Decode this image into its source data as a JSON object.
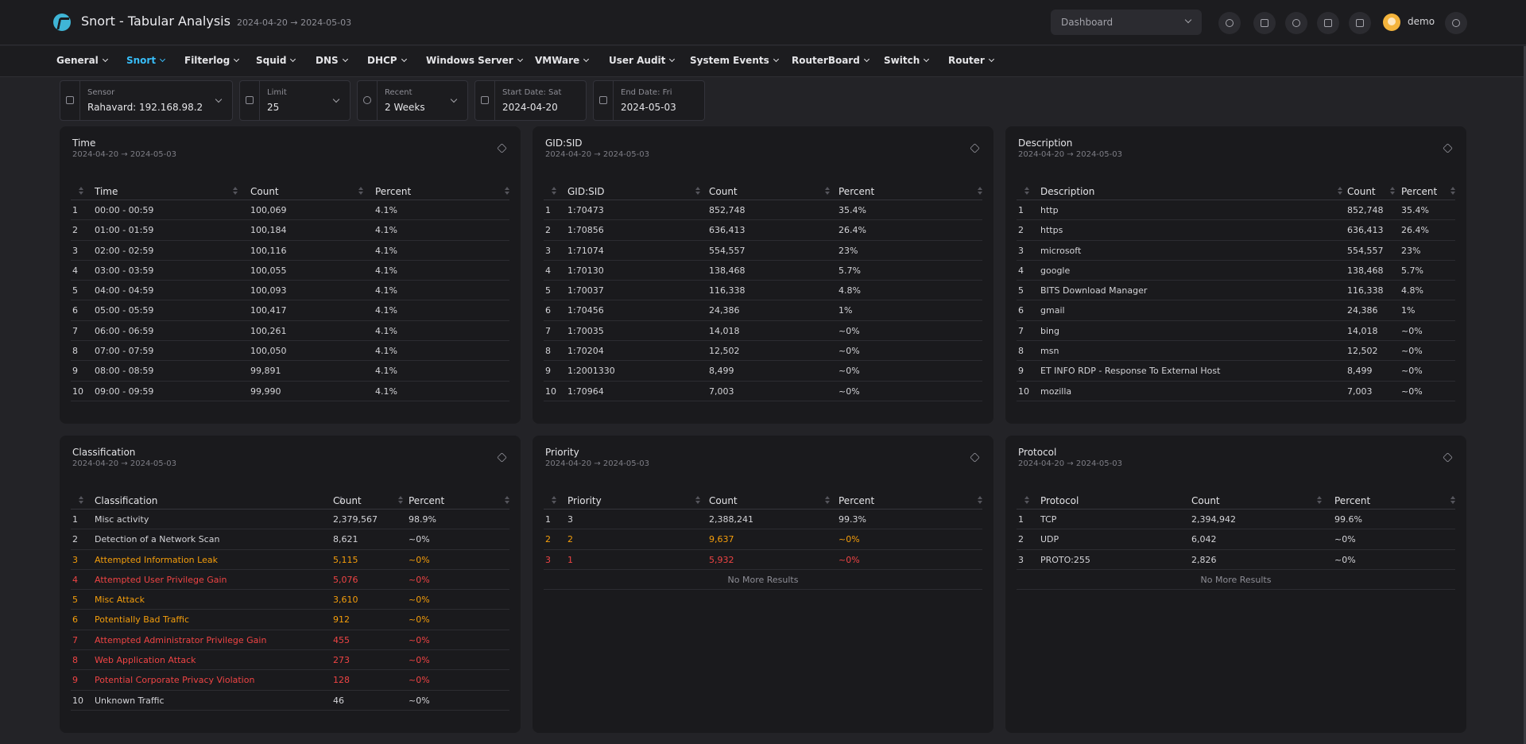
{
  "header": {
    "title": "Snort - Tabular Analysis",
    "range": "2024-04-20 → 2024-05-03",
    "dashboard_select": "Dashboard",
    "user": "demo",
    "icons": [
      "sun-icon",
      "fullscreen-icon",
      "alert-icon",
      "device-icon",
      "briefcase-icon"
    ]
  },
  "nav": {
    "items": [
      {
        "label": "General"
      },
      {
        "label": "Snort"
      },
      {
        "label": "Filterlog"
      },
      {
        "label": "Squid"
      },
      {
        "label": "DNS"
      },
      {
        "label": "DHCP"
      },
      {
        "label": "Windows Server"
      },
      {
        "label": "VMWare"
      },
      {
        "label": "User Audit"
      },
      {
        "label": "System Events"
      },
      {
        "label": "RouterBoard"
      },
      {
        "label": "Switch"
      },
      {
        "label": "Router"
      }
    ]
  },
  "filters": {
    "sensor": {
      "label": "Sensor",
      "value": "Rahavard: 192.168.98.2"
    },
    "limit": {
      "label": "Limit",
      "value": "25"
    },
    "recent": {
      "label": "Recent",
      "value": "2 Weeks"
    },
    "start": {
      "label": "Start Date: Sat",
      "value": "2024-04-20"
    },
    "end": {
      "label": "End Date: Fri",
      "value": "2024-05-03"
    }
  },
  "no_more": "No More Results",
  "status_colors": {
    "normal": "#d4d4d8",
    "orange": "#f59e0b",
    "red": "#ef4444",
    "active_nav": "#38bdf8"
  },
  "panels": [
    {
      "title": "Time",
      "range": "2024-04-20 → 2024-05-03",
      "columns": [
        "Time",
        "Count",
        "Percent"
      ],
      "rows": [
        [
          "1",
          "00:00 - 00:59",
          "100,069",
          "4.1%"
        ],
        [
          "2",
          "01:00 - 01:59",
          "100,184",
          "4.1%"
        ],
        [
          "3",
          "02:00 - 02:59",
          "100,116",
          "4.1%"
        ],
        [
          "4",
          "03:00 - 03:59",
          "100,055",
          "4.1%"
        ],
        [
          "5",
          "04:00 - 04:59",
          "100,093",
          "4.1%"
        ],
        [
          "6",
          "05:00 - 05:59",
          "100,417",
          "4.1%"
        ],
        [
          "7",
          "06:00 - 06:59",
          "100,261",
          "4.1%"
        ],
        [
          "8",
          "07:00 - 07:59",
          "100,050",
          "4.1%"
        ],
        [
          "9",
          "08:00 - 08:59",
          "99,891",
          "4.1%"
        ],
        [
          "10",
          "09:00 - 09:59",
          "99,990",
          "4.1%"
        ]
      ],
      "no_more": false
    },
    {
      "title": "GID:SID",
      "range": "2024-04-20 → 2024-05-03",
      "columns": [
        "GID:SID",
        "Count",
        "Percent"
      ],
      "rows": [
        [
          "1",
          "1:70473",
          "852,748",
          "35.4%"
        ],
        [
          "2",
          "1:70856",
          "636,413",
          "26.4%"
        ],
        [
          "3",
          "1:71074",
          "554,557",
          "23%"
        ],
        [
          "4",
          "1:70130",
          "138,468",
          "5.7%"
        ],
        [
          "5",
          "1:70037",
          "116,338",
          "4.8%"
        ],
        [
          "6",
          "1:70456",
          "24,386",
          "1%"
        ],
        [
          "7",
          "1:70035",
          "14,018",
          "~0%"
        ],
        [
          "8",
          "1:70204",
          "12,502",
          "~0%"
        ],
        [
          "9",
          "1:2001330",
          "8,499",
          "~0%"
        ],
        [
          "10",
          "1:70964",
          "7,003",
          "~0%"
        ]
      ],
      "no_more": false
    },
    {
      "title": "Description",
      "range": "2024-04-20 → 2024-05-03",
      "columns": [
        "Description",
        "Count",
        "Percent"
      ],
      "rows": [
        [
          "1",
          "http",
          "852,748",
          "35.4%"
        ],
        [
          "2",
          "https",
          "636,413",
          "26.4%"
        ],
        [
          "3",
          "microsoft",
          "554,557",
          "23%"
        ],
        [
          "4",
          "google",
          "138,468",
          "5.7%"
        ],
        [
          "5",
          "BITS Download Manager",
          "116,338",
          "4.8%"
        ],
        [
          "6",
          "gmail",
          "24,386",
          "1%"
        ],
        [
          "7",
          "bing",
          "14,018",
          "~0%"
        ],
        [
          "8",
          "msn",
          "12,502",
          "~0%"
        ],
        [
          "9",
          "ET INFO RDP - Response To External Host",
          "8,499",
          "~0%"
        ],
        [
          "10",
          "mozilla",
          "7,003",
          "~0%"
        ]
      ],
      "no_more": false
    },
    {
      "title": "Classification",
      "range": "2024-04-20 → 2024-05-03",
      "columns": [
        "Classification",
        "Count",
        "Percent"
      ],
      "rows": [
        [
          "1",
          "Misc activity",
          "2,379,567",
          "98.9%"
        ],
        [
          "2",
          "Detection of a Network Scan",
          "8,621",
          "~0%"
        ],
        [
          "3",
          "Attempted Information Leak",
          "5,115",
          "~0%"
        ],
        [
          "4",
          "Attempted User Privilege Gain",
          "5,076",
          "~0%"
        ],
        [
          "5",
          "Misc Attack",
          "3,610",
          "~0%"
        ],
        [
          "6",
          "Potentially Bad Traffic",
          "912",
          "~0%"
        ],
        [
          "7",
          "Attempted Administrator Privilege Gain",
          "455",
          "~0%"
        ],
        [
          "8",
          "Web Application Attack",
          "273",
          "~0%"
        ],
        [
          "9",
          "Potential Corporate Privacy Violation",
          "128",
          "~0%"
        ],
        [
          "10",
          "Unknown Traffic",
          "46",
          "~0%"
        ]
      ],
      "row_status": [
        "normal",
        "normal",
        "orange",
        "red",
        "orange",
        "orange",
        "red",
        "red",
        "red",
        "normal"
      ],
      "no_more": false
    },
    {
      "title": "Priority",
      "range": "2024-04-20 → 2024-05-03",
      "columns": [
        "Priority",
        "Count",
        "Percent"
      ],
      "rows": [
        [
          "1",
          "3",
          "2,388,241",
          "99.3%"
        ],
        [
          "2",
          "2",
          "9,637",
          "~0%"
        ],
        [
          "3",
          "1",
          "5,932",
          "~0%"
        ]
      ],
      "row_status": [
        "normal",
        "orange",
        "red"
      ],
      "no_more": true
    },
    {
      "title": "Protocol",
      "range": "2024-04-20 → 2024-05-03",
      "columns": [
        "Protocol",
        "Count",
        "Percent"
      ],
      "rows": [
        [
          "1",
          "TCP",
          "2,394,942",
          "99.6%"
        ],
        [
          "2",
          "UDP",
          "6,042",
          "~0%"
        ],
        [
          "3",
          "PROTO:255",
          "2,826",
          "~0%"
        ]
      ],
      "no_more": true
    }
  ]
}
